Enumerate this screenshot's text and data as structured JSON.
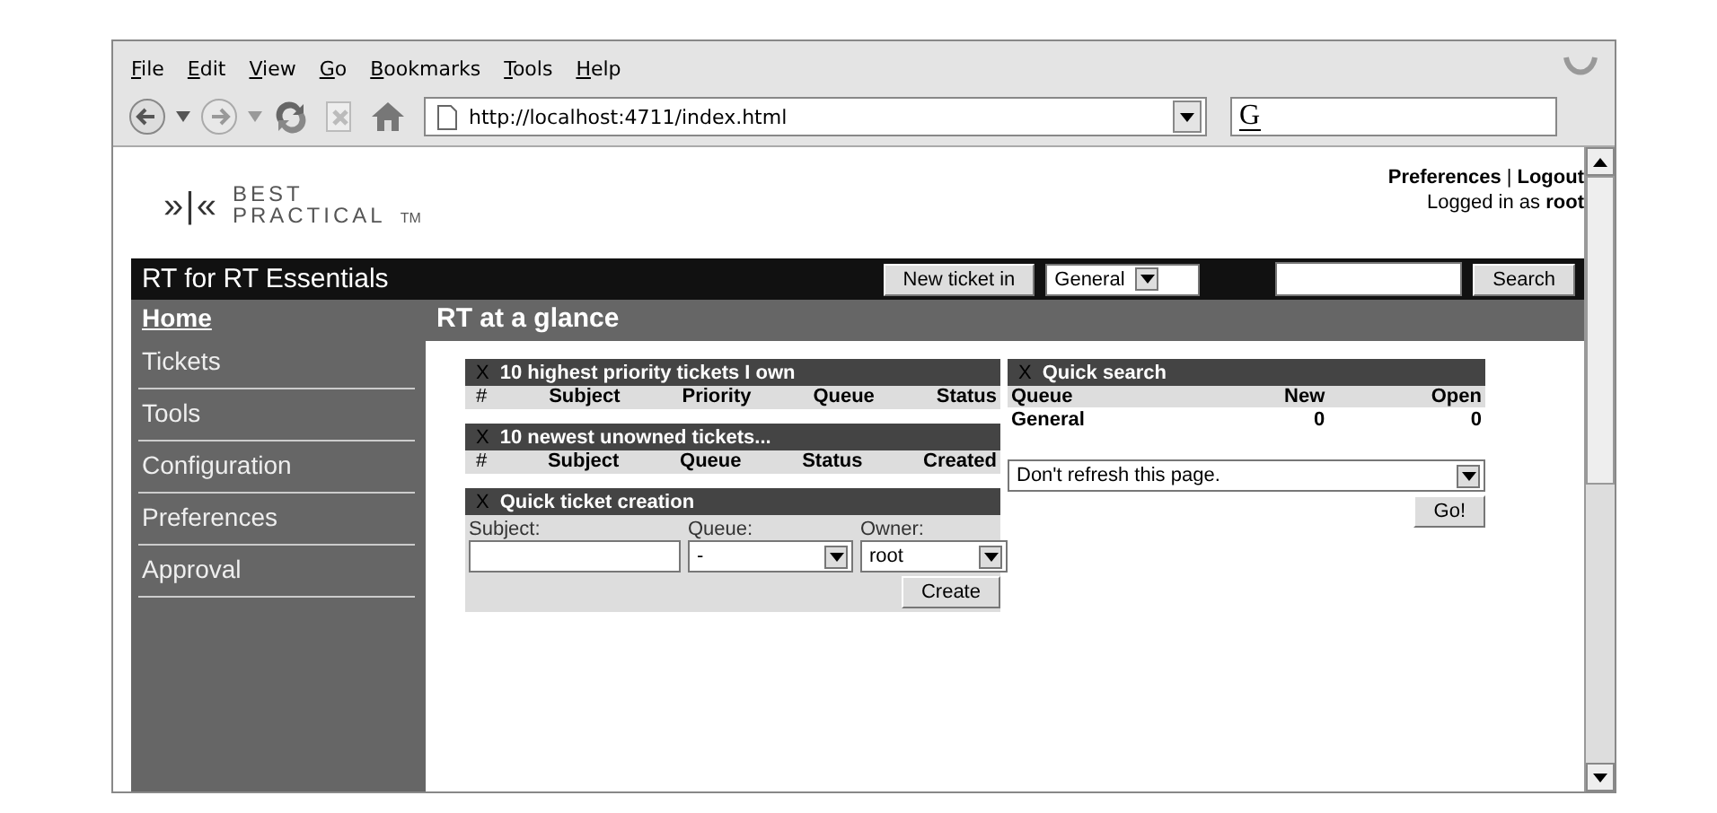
{
  "browser": {
    "menu": [
      "File",
      "Edit",
      "View",
      "Go",
      "Bookmarks",
      "Tools",
      "Help"
    ],
    "address": "http://localhost:4711/index.html",
    "search_logo": "G"
  },
  "header": {
    "logo_mark": "»|«",
    "logo_line1": "BEST",
    "logo_line2": "PRACTICAL",
    "logo_tm": "TM",
    "links": [
      "Preferences",
      "Logout"
    ],
    "separator": "|",
    "logged_in": "Logged in as",
    "user": "root"
  },
  "topbar": {
    "title": "RT for RT Essentials",
    "new_ticket_button": "New ticket in",
    "queue_select": "General",
    "search_button": "Search"
  },
  "sidebar": {
    "items": [
      {
        "label": "Home",
        "selected": true
      },
      {
        "label": "Tickets",
        "selected": false
      },
      {
        "label": "Tools",
        "selected": false
      },
      {
        "label": "Configuration",
        "selected": false
      },
      {
        "label": "Preferences",
        "selected": false
      },
      {
        "label": "Approval",
        "selected": false
      }
    ]
  },
  "page_title": "RT at a glance",
  "left_boxes": [
    {
      "close": "X",
      "title": "10 highest priority tickets I own",
      "columns": [
        "#",
        "Subject",
        "Priority",
        "Queue",
        "Status"
      ]
    },
    {
      "close": "X",
      "title": "10 newest unowned tickets...",
      "columns": [
        "#",
        "Subject",
        "Queue",
        "Status",
        "Created"
      ]
    }
  ],
  "quick_create": {
    "close": "X",
    "title": "Quick ticket creation",
    "subject_label": "Subject:",
    "queue_label": "Queue:",
    "queue_value": "-",
    "owner_label": "Owner:",
    "owner_value": "root",
    "button": "Create"
  },
  "quick_search": {
    "close": "X",
    "title": "Quick search",
    "columns": [
      "Queue",
      "New",
      "Open"
    ],
    "rows": [
      [
        "General",
        "0",
        "0"
      ]
    ]
  },
  "refresh": {
    "value": "Don't refresh this page.",
    "button": "Go!"
  }
}
